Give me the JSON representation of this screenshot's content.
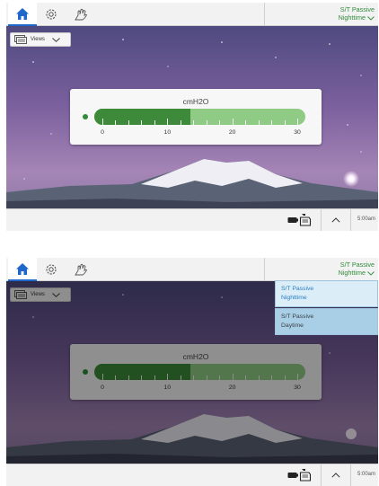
{
  "screens": [
    {
      "mode": {
        "line1": "S/T Passive",
        "line2": "Nighttime"
      },
      "views_label": "Views",
      "gauge": {
        "unit": "cmH2O",
        "value": 13.5,
        "max": 30,
        "tick_labels": [
          "0",
          "10",
          "20",
          "30"
        ]
      },
      "time": "5:00am",
      "dropdown_open": false
    },
    {
      "mode": {
        "line1": "S/T Passive",
        "line2": "Nighttime"
      },
      "views_label": "Views",
      "gauge": {
        "unit": "cmH2O",
        "value": 13.5,
        "max": 30,
        "tick_labels": [
          "0",
          "10",
          "20",
          "30"
        ]
      },
      "time": "5:00am",
      "dropdown_open": true,
      "dropdown": [
        {
          "line1": "S/T Passive",
          "line2": "Nighttime"
        },
        {
          "line1": "S/T Passive",
          "line2": "Daytime"
        }
      ]
    }
  ],
  "colors": {
    "accent_blue": "#1f67c8",
    "mode_green": "#2f8c3a",
    "gauge_fill_dark": "#3d8b3a",
    "gauge_fill_light": "#8fcb84",
    "dropdown_selected": "#dbeef8",
    "dropdown_option": "#a9cfe6"
  },
  "icons": {
    "home": "home-icon",
    "settings": "gear-icon",
    "hand": "hand-icon",
    "views": "views-icon",
    "battery": "battery-icon",
    "sd_card": "sd-card-icon",
    "up": "chevron-up-icon",
    "status": "status-dot"
  }
}
